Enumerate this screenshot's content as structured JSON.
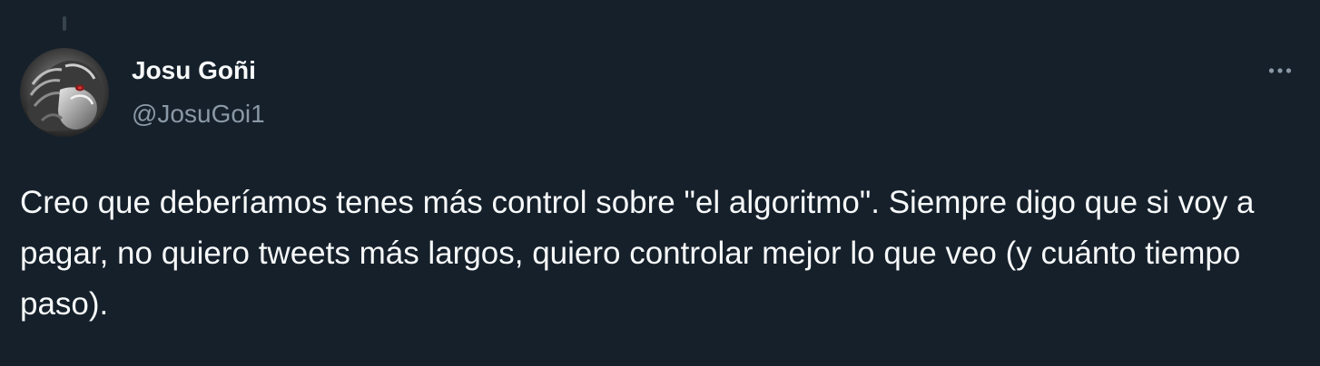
{
  "tweet": {
    "author": {
      "display_name": "Josu Goñi",
      "handle": "@JosuGoi1",
      "avatar_icon": "avatar-image"
    },
    "more_icon": "more-options-icon",
    "text": "Creo que deberíamos tenes más control sobre \"el algoritmo\". Siempre digo que si voy a pagar, no quiero tweets más largos, quiero controlar mejor lo que veo (y cuánto tiempo paso)."
  },
  "colors": {
    "background": "#15202b",
    "text_primary": "#f7f9f9",
    "text_secondary": "#8b98a5",
    "thread_line": "#38444d"
  }
}
